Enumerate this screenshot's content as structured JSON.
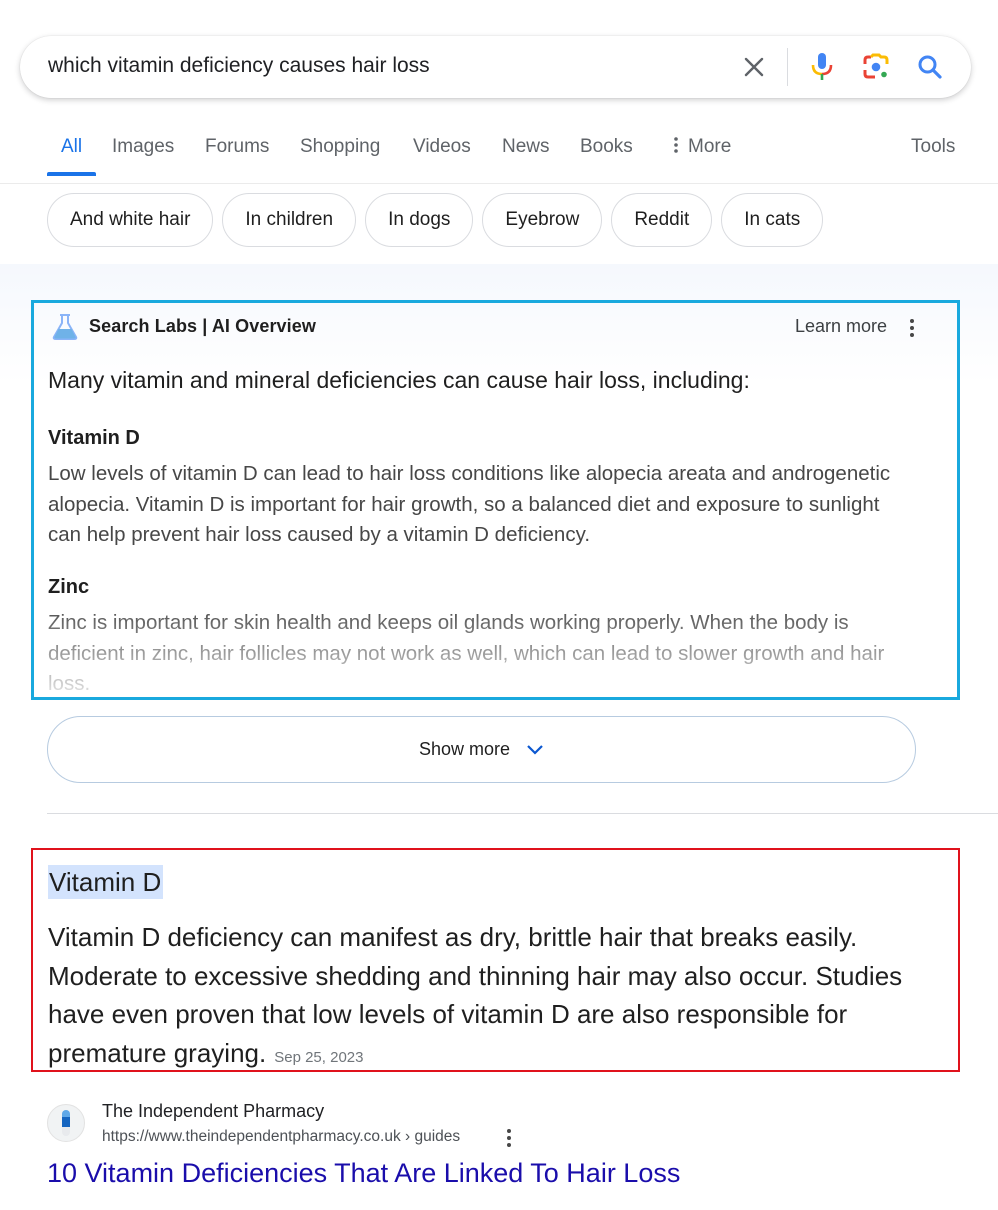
{
  "search": {
    "query": "which vitamin deficiency causes hair loss",
    "icons": [
      "clear-icon",
      "microphone-icon",
      "google-lens-icon",
      "search-icon"
    ]
  },
  "tabs": [
    {
      "label": "All",
      "active": true
    },
    {
      "label": "Images"
    },
    {
      "label": "Forums"
    },
    {
      "label": "Shopping"
    },
    {
      "label": "Videos"
    },
    {
      "label": "News"
    },
    {
      "label": "Books"
    },
    {
      "label": "More",
      "icon": "more-vertical-icon"
    }
  ],
  "tools_label": "Tools",
  "chips": [
    "And white hair",
    "In children",
    "In dogs",
    "Eyebrow",
    "Reddit",
    "In cats"
  ],
  "ai_overview": {
    "title": "Search Labs | AI Overview",
    "learn_more": "Learn more",
    "lead": "Many vitamin and mineral deficiencies can cause hair loss, including:",
    "sections": [
      {
        "heading": "Vitamin D",
        "text": "Low levels of vitamin D can lead to hair loss conditions like alopecia areata and androgenetic alopecia. Vitamin D is important for hair growth, so a balanced diet and exposure to sunlight can help prevent hair loss caused by a vitamin D deficiency."
      },
      {
        "heading": "Zinc",
        "text": "Zinc is important for skin health and keeps oil glands working properly. When the body is deficient in zinc, hair follicles may not work as well, which can lead to slower growth and hair loss."
      }
    ],
    "show_more": "Show more",
    "border_color": "#19a9de"
  },
  "featured_snippet": {
    "title": "Vitamin D",
    "text": "Vitamin D deficiency can manifest as dry, brittle hair that breaks easily. Moderate to excessive shedding and thinning hair may also occur. Studies have even proven that low levels of vitamin D are also responsible for premature graying.",
    "date": "Sep 25, 2023",
    "border_color": "#e0121c"
  },
  "result": {
    "site_name": "The Independent Pharmacy",
    "url": "https://www.theindependentpharmacy.co.uk › guides",
    "title": "10 Vitamin Deficiencies That Are Linked To Hair Loss"
  },
  "colors": {
    "accent_blue": "#1a73e8",
    "link": "#1a0dab",
    "highlight": "#d3e3fd"
  }
}
